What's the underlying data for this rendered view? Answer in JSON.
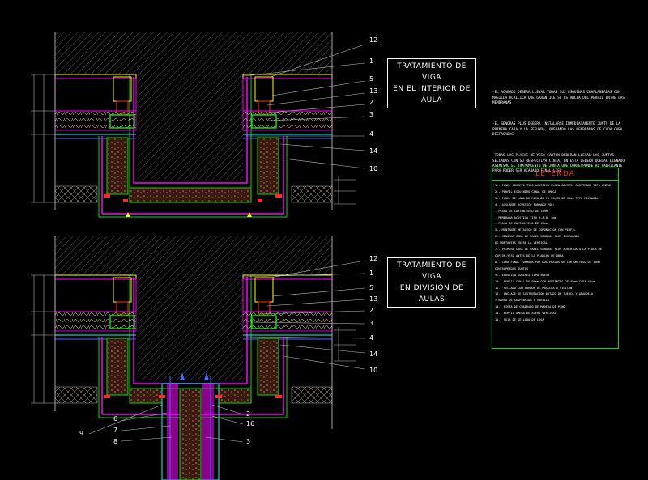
{
  "titles": {
    "top": [
      "TRATAMIENTO DE VIGA",
      "EN EL INTERIOR DE AULA"
    ],
    "bottom": [
      "TRATAMIENTO DE VIGA",
      "EN DIVISION DE AULAS"
    ]
  },
  "notes": [
    "-EL ACABADO DEBERA LLEVAR TODAS SUS ESQUINAS CHAFLANEADAS CON MASILLA ACRILICA QUE GARANTICE SU ESTANCIA DEL PERFIL ENTRE LAS MEMBRANAS",
    "-EL SENORAS PLUS DEBERA INSTALARSE INMEDIATAMENTE JUNTO DE LA PRIMERA CARA Y LA SEGUNDA, QUEDANDO LAS MEMBRANAS DE CADA CARA DESFASADAS",
    "-TODAS LAS PLACAS DE YESO-CARTON DEBERAN LLEVAR LAS JUNTAS SELLADAS CON SU RESPECTIVA CINTA, EN ESTA DEBERA QUEDAR LLENADO ASIMISMO EL TRATAMIENTO DE JUNTA QUE CORRESPONDE AL FABRICANTE PARA PODER SER ACABADO FINAL LISO"
  ],
  "legend": {
    "title": "LEYENDA",
    "items": [
      "1.- PANEL ABIERTO TIPO ACUSTICO PLACA ACUSTIC ARMSTRONG TIPO AMBRO",
      "2.- PERFIL ESQUINERO CANAL DE OMEGA",
      "3.- PANEL DE LANA DE ROCA DE 75 KG/M3 DE 40mm TIPO ROCKWOOL",
      "4.- AISLANTE ACUSTICO FORMADO POR:",
      "   - PLACA DE CARTON-YESO DE 15MM",
      "   - MEMBRANA ACUSTICA TIPO M.A.D. 4mm",
      "   - PLACA DE CARTON-YESO DE 15mm",
      "5.- MONTANTE METALICO DE CORONACION CON PERFIL",
      "6.- SENORAS CARA DE PANEL SENORAS PLUS INSTALADA",
      "   DE MONTANTES ENTRE LA VERTICAL",
      "7.- PRIMERA CARA DE PANEL SENORAS PLUS ADHERIDA A LA PLACA DE",
      "   CARTON-YESO ANTES DE LA PLANCHA DE OBRA",
      "8.- CARA FINAL FORMADA POR DOS PLACAS DE CARTON-YESO DE 15mm",
      "   CONTRAPEADAS JUNTAS",
      "9.- ELASTICO SORIMEX TIPO 90x40",
      "10.- PERFIL CANAL DE 90mm CON MONTANTES DE 48mm CADA 40cm",
      "11.- SELLADO CON CORDON DE MASILLA O SILICON",
      "12.- ANCLAJE DE SUSTENTACION DOTADO DE TUERCA Y ARANDELA",
      "   Y BARRA DE SUSPENSION A VARILLA",
      "13.- PIEZA DE CUADRADO DE MADERA DE PINO",
      "14.- PERFIL OMEGA DE ACERO VERTICAL",
      "15.- GUIA DE SELLADO DE LOSA"
    ]
  },
  "callouts": {
    "top": [
      "12",
      "1",
      "5",
      "13",
      "2",
      "3",
      "4",
      "14",
      "10"
    ],
    "bottom_right": [
      "12",
      "1",
      "5",
      "13",
      "2",
      "3",
      "4",
      "14",
      "10"
    ],
    "bottom_left": [
      "9",
      "6",
      "7",
      "8"
    ],
    "bottom_center": [
      "2",
      "16",
      "3"
    ]
  },
  "colors": {
    "background": "#000000",
    "magenta": "#ff00ff",
    "green": "#00e000",
    "yellow": "#ffff00",
    "red": "#ff2a2a",
    "cyan": "#00ffff",
    "blue": "#4a6bff",
    "gray": "#9a9a9a"
  }
}
